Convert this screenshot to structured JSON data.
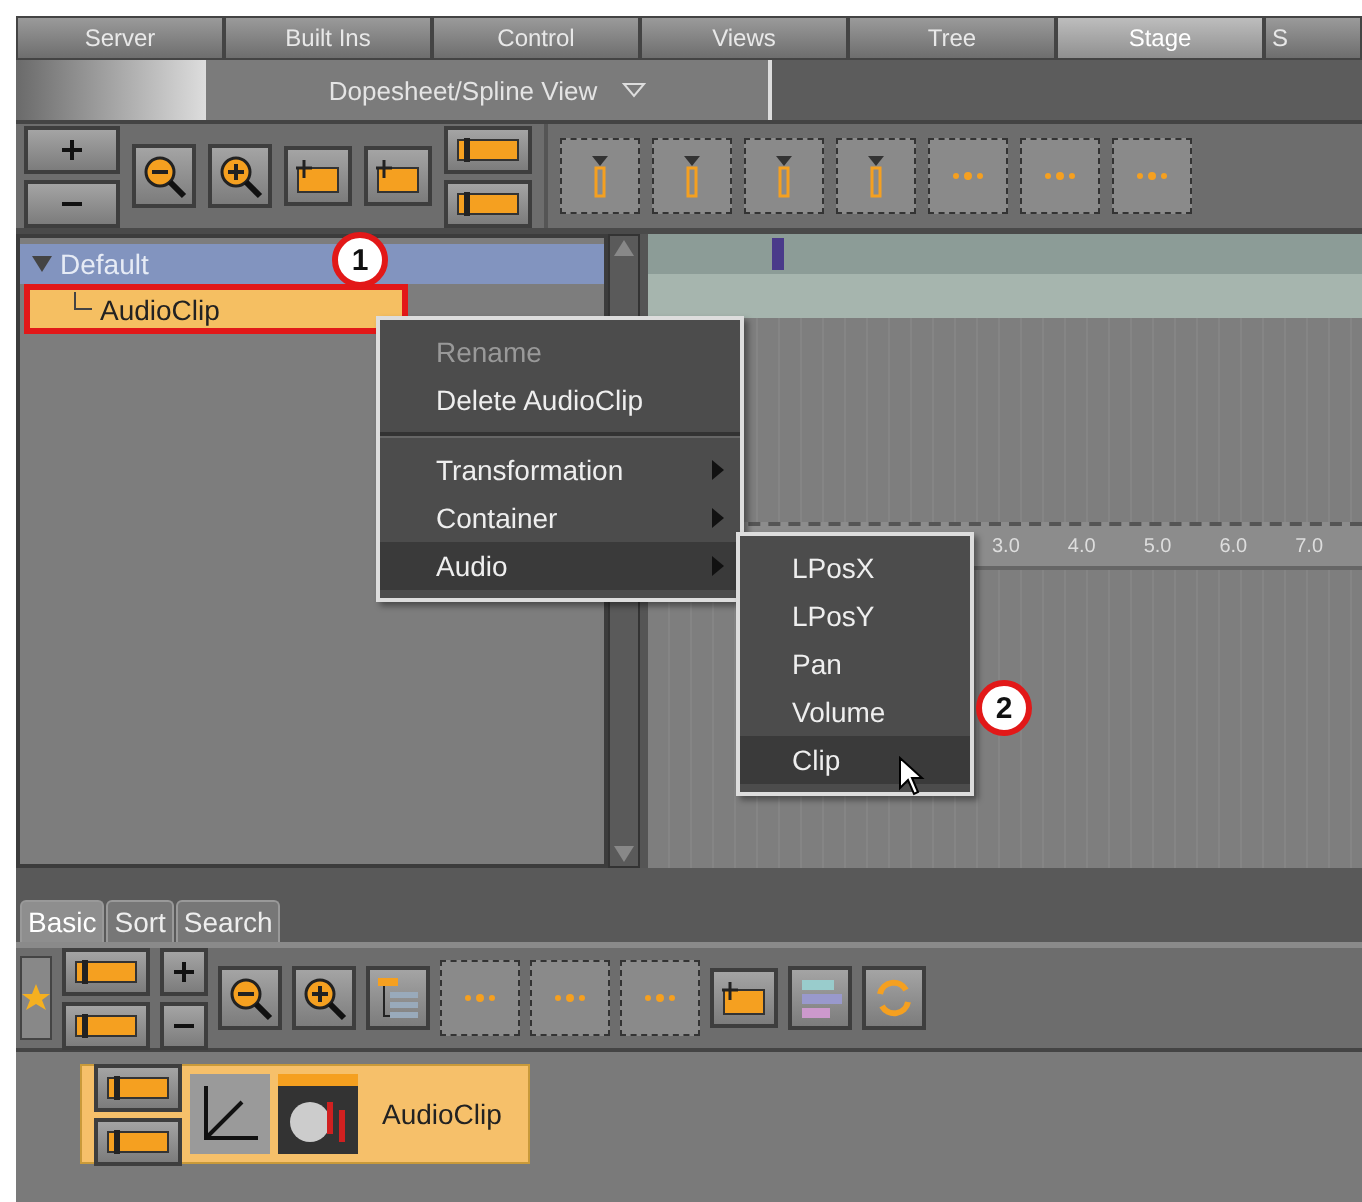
{
  "top_tabs": [
    {
      "label": "Server",
      "selected": false
    },
    {
      "label": "Built Ins",
      "selected": false
    },
    {
      "label": "Control",
      "selected": false
    },
    {
      "label": "Views",
      "selected": false
    },
    {
      "label": "Tree",
      "selected": false
    },
    {
      "label": "Stage",
      "selected": true
    },
    {
      "label": "S",
      "selected": false
    }
  ],
  "view_selector": {
    "value": "Dopesheet/Spline View"
  },
  "tree": [
    {
      "label": "Default",
      "expanded": true,
      "selected": false,
      "children": [
        {
          "label": "AudioClip",
          "selected": true
        }
      ]
    }
  ],
  "annotations": [
    {
      "label": "1"
    },
    {
      "label": "2"
    }
  ],
  "context_menu": {
    "items": [
      {
        "kind": "item",
        "label": "Rename",
        "disabled": true,
        "selected": false,
        "submenu": false
      },
      {
        "kind": "item",
        "label": "Delete AudioClip",
        "disabled": false,
        "selected": false,
        "submenu": false
      },
      {
        "kind": "separator"
      },
      {
        "kind": "item",
        "label": "Transformation",
        "disabled": false,
        "selected": false,
        "submenu": true
      },
      {
        "kind": "item",
        "label": "Container",
        "disabled": false,
        "selected": false,
        "submenu": true
      },
      {
        "kind": "item",
        "label": "Audio",
        "disabled": false,
        "selected": true,
        "submenu": true
      }
    ]
  },
  "submenu": {
    "items": [
      {
        "label": "LPosX",
        "selected": false
      },
      {
        "label": "LPosY",
        "selected": false
      },
      {
        "label": "Pan",
        "selected": false
      },
      {
        "label": "Volume",
        "selected": false
      },
      {
        "label": "Clip",
        "selected": true
      }
    ]
  },
  "timeline": {
    "ruler": [
      "3.0",
      "4.0",
      "5.0",
      "6.0",
      "7.0"
    ]
  },
  "bottom_tabs": [
    {
      "label": "Basic",
      "selected": true
    },
    {
      "label": "Sort",
      "selected": false
    },
    {
      "label": "Search",
      "selected": false
    }
  ],
  "item_card": {
    "label": "AudioClip",
    "selected": true
  }
}
